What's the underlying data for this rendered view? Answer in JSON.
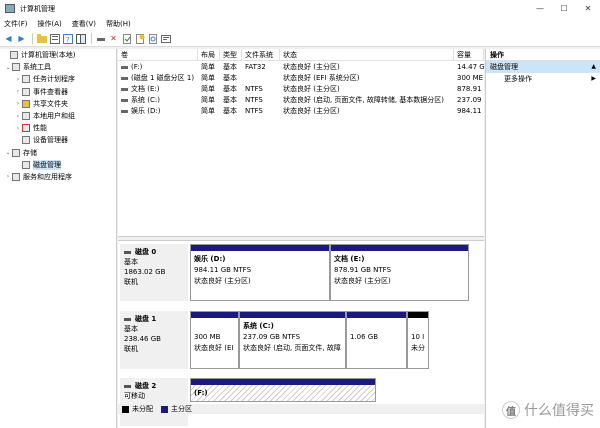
{
  "window": {
    "title": "计算机管理",
    "controls": {
      "minimize": "—",
      "maximize": "☐",
      "close": "✕"
    }
  },
  "menu": [
    "文件(F)",
    "操作(A)",
    "查看(V)",
    "帮助(H)"
  ],
  "tree": [
    {
      "label": "计算机管理(本地)",
      "arrow": "",
      "indent": 0
    },
    {
      "label": "系统工具",
      "arrow": "⌄",
      "indent": 1
    },
    {
      "label": "任务计划程序",
      "arrow": "›",
      "indent": 2
    },
    {
      "label": "事件查看器",
      "arrow": "›",
      "indent": 2
    },
    {
      "label": "共享文件夹",
      "arrow": "›",
      "indent": 2
    },
    {
      "label": "本地用户和组",
      "arrow": "›",
      "indent": 2
    },
    {
      "label": "性能",
      "arrow": "›",
      "indent": 2
    },
    {
      "label": "设备管理器",
      "arrow": "",
      "indent": 2
    },
    {
      "label": "存储",
      "arrow": "⌄",
      "indent": 1
    },
    {
      "label": "磁盘管理",
      "arrow": "",
      "indent": 2,
      "selected": true
    },
    {
      "label": "服务和应用程序",
      "arrow": "›",
      "indent": 1
    }
  ],
  "volume_headers": [
    "卷",
    "布局",
    "类型",
    "文件系统",
    "状态",
    "容量"
  ],
  "volumes": [
    {
      "name": "(F:)",
      "layout": "简单",
      "type": "基本",
      "fs": "FAT32",
      "status": "状态良好 (主分区)",
      "capacity": "14.47 G"
    },
    {
      "name": "(磁盘 1 磁盘分区 1)",
      "layout": "简单",
      "type": "基本",
      "fs": "",
      "status": "状态良好 (EFI 系统分区)",
      "capacity": "300 ME"
    },
    {
      "name": "文档 (E:)",
      "layout": "简单",
      "type": "基本",
      "fs": "NTFS",
      "status": "状态良好 (主分区)",
      "capacity": "878.91"
    },
    {
      "name": "系统 (C:)",
      "layout": "简单",
      "type": "基本",
      "fs": "NTFS",
      "status": "状态良好 (启动, 页面文件, 故障转储, 基本数据分区)",
      "capacity": "237.09"
    },
    {
      "name": "娱乐 (D:)",
      "layout": "简单",
      "type": "基本",
      "fs": "NTFS",
      "status": "状态良好 (主分区)",
      "capacity": "984.11"
    }
  ],
  "disks": [
    {
      "name": "磁盘 0",
      "kind": "基本",
      "size": "1863.02 GB",
      "state": "联机",
      "partitions": [
        {
          "name": "娱乐 (D:)",
          "size": "984.11 GB NTFS",
          "status": "状态良好 (主分区)"
        },
        {
          "name": "文档 (E:)",
          "size": "878.91 GB NTFS",
          "status": "状态良好 (主分区)"
        }
      ]
    },
    {
      "name": "磁盘 1",
      "kind": "基本",
      "size": "238.46 GB",
      "state": "联机",
      "partitions": [
        {
          "name": "",
          "size": "300 MB",
          "status": "状态良好 (EI"
        },
        {
          "name": "系统 (C:)",
          "size": "237.09 GB NTFS",
          "status": "状态良好 (启动, 页面文件, 故障"
        },
        {
          "name": "",
          "size": "1.06 GB",
          "status": ""
        },
        {
          "name": "",
          "size": "10 I",
          "status": "未分"
        }
      ]
    },
    {
      "name": "磁盘 2",
      "kind": "可移动",
      "size": "",
      "state": "",
      "partitions": [
        {
          "name": "(F:)",
          "size": "",
          "status": ""
        }
      ]
    }
  ],
  "legend": [
    {
      "label": "未分配",
      "color": "#000000"
    },
    {
      "label": "主分区",
      "color": "#1a1a80"
    }
  ],
  "actions": {
    "header": "操作",
    "section": "磁盘管理",
    "items": [
      "更多操作"
    ]
  },
  "watermark": {
    "icon": "值",
    "text": "什么值得买"
  }
}
